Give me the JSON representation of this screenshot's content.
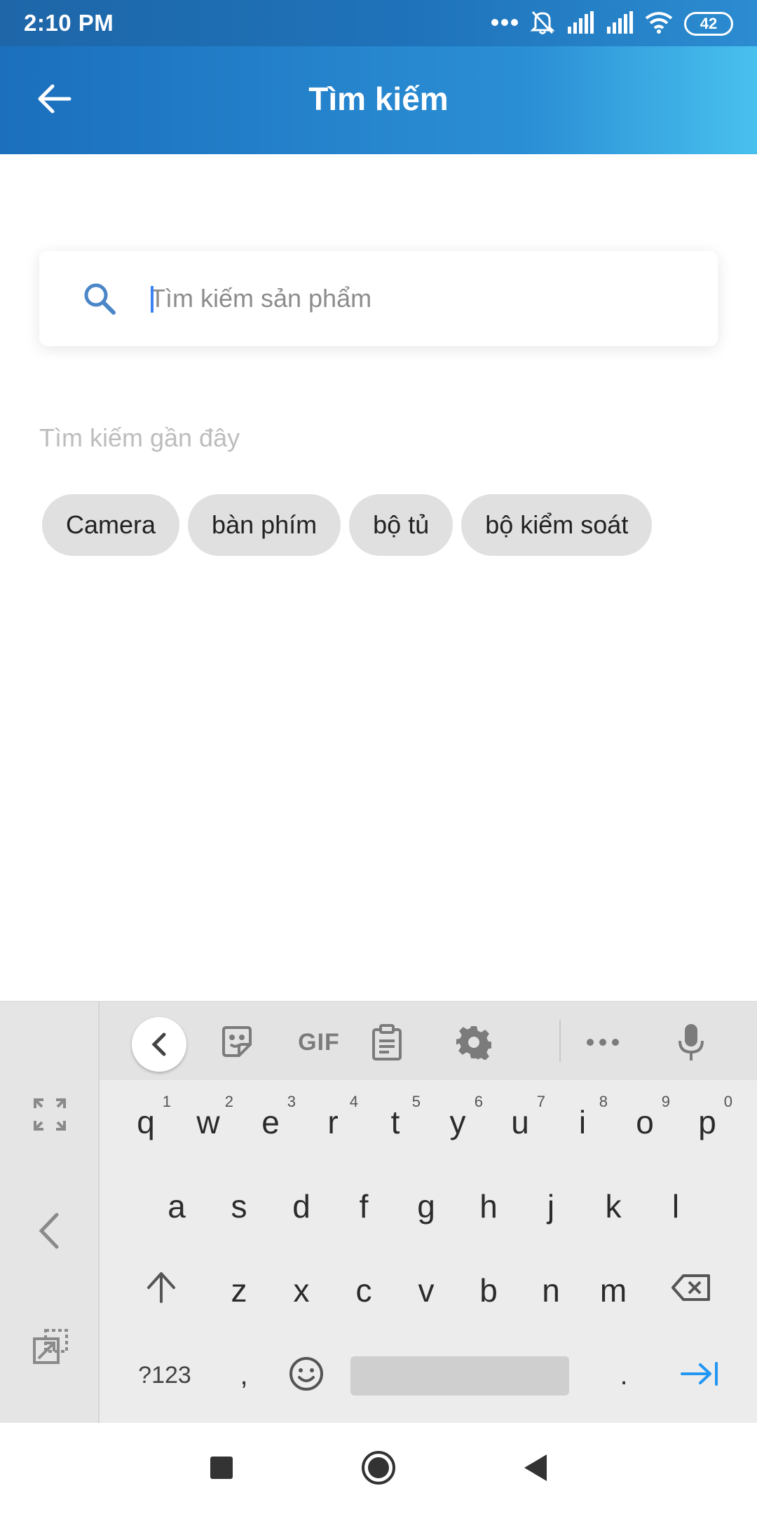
{
  "status_bar": {
    "time": "2:10 PM",
    "battery": "42",
    "icons": [
      "more-dots-icon",
      "mute-icon",
      "signal-icon",
      "signal-icon",
      "wifi-icon",
      "battery-icon"
    ]
  },
  "header": {
    "title": "Tìm kiếm",
    "back_icon": "arrow-left-icon"
  },
  "search": {
    "placeholder": "Tìm kiếm sản phẩm",
    "value": "",
    "icon": "search-icon"
  },
  "recent": {
    "title": "Tìm kiếm gần đây",
    "items": [
      "Camera",
      "bàn phím",
      "bộ tủ",
      "bộ kiểm soát"
    ]
  },
  "keyboard": {
    "toolbar": {
      "gif_label": "GIF",
      "icons": [
        "chevron-left-icon",
        "sticker-icon",
        "gif-icon",
        "clipboard-icon",
        "settings-icon",
        "more-icon",
        "microphone-icon"
      ]
    },
    "row1": [
      {
        "key": "q",
        "hint": "1"
      },
      {
        "key": "w",
        "hint": "2"
      },
      {
        "key": "e",
        "hint": "3"
      },
      {
        "key": "r",
        "hint": "4"
      },
      {
        "key": "t",
        "hint": "5"
      },
      {
        "key": "y",
        "hint": "6"
      },
      {
        "key": "u",
        "hint": "7"
      },
      {
        "key": "i",
        "hint": "8"
      },
      {
        "key": "o",
        "hint": "9"
      },
      {
        "key": "p",
        "hint": "0"
      }
    ],
    "row2": [
      "a",
      "s",
      "d",
      "f",
      "g",
      "h",
      "j",
      "k",
      "l"
    ],
    "row3": [
      "z",
      "x",
      "c",
      "v",
      "b",
      "n",
      "m"
    ],
    "symbols_label": "?123",
    "comma_label": ",",
    "period_label": ".",
    "side_icons": [
      "expand-icon",
      "chevron-left-icon",
      "floating-keyboard-icon"
    ],
    "shift_icon": "shift-icon",
    "backspace_icon": "backspace-icon",
    "emoji_icon": "emoji-icon",
    "enter_icon": "tab-enter-icon",
    "accent_color": "#2196f3"
  },
  "nav_bar": {
    "icons": [
      "square-icon",
      "home-circle-icon",
      "back-triangle-icon"
    ]
  }
}
